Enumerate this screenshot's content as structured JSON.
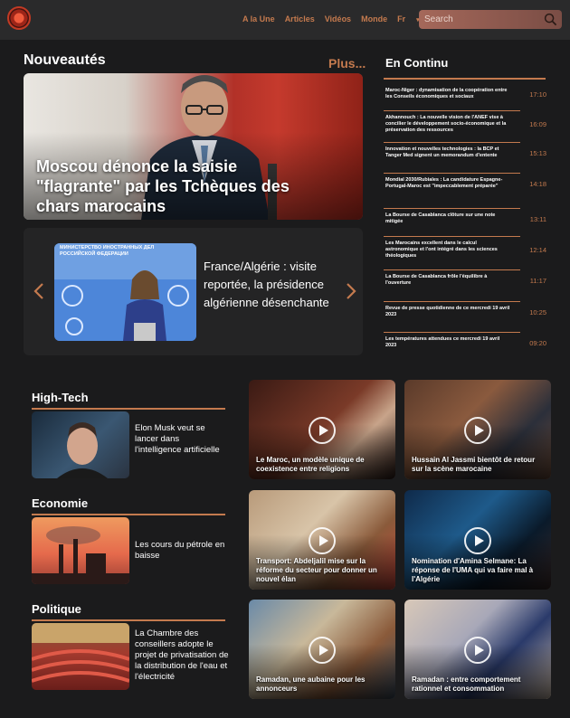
{
  "nav": {
    "items": [
      "A la Une",
      "Articles",
      "Vidéos",
      "Monde",
      "Fr"
    ]
  },
  "search": {
    "placeholder": "Search"
  },
  "nouveautes": {
    "title": "Nouveautés",
    "more": "Plus...",
    "hero_title": "Moscou dénonce la saisie \"flagrante\" par les Tchèques des chars marocains",
    "slide_text": "France/Algérie : visite reportée, la présidence algérienne désenchante",
    "slide_sign": "МИНИСТЕРСТВО ИНОСТРАННЫХ ДЕЛ РОССИЙСКОЙ ФЕДЕРАЦИИ"
  },
  "continu": {
    "title": "En Continu",
    "items": [
      {
        "text": "Maroc-Niger : dynamisation de la coopération entre les Conseils économiques et sociaux",
        "time": "17:10"
      },
      {
        "text": "Akhannouch : La nouvelle vision de l'ANEF vise à concilier le développement socio-économique et la préservation des ressources",
        "time": "16:09"
      },
      {
        "text": "Innovation et nouvelles technologies : la BCP et Tanger Med signent un memorandum d'entente",
        "time": "15:13"
      },
      {
        "text": "Mondial 2030/Rubiales : La candidature Espagne-Portugal-Maroc est \"impeccablement préparée\"",
        "time": "14:18"
      },
      {
        "text": "La Bourse de Casablanca clôture sur une note mitigée",
        "time": "13:11"
      },
      {
        "text": "Les Marocains excellent dans le calcul astronomique et l'ont intégré dans les sciences théologiques",
        "time": "12:14"
      },
      {
        "text": "La Bourse de Casablanca frôle l'équilibre à l'ouverture",
        "time": "11:17"
      },
      {
        "text": "Revue de presse quotidienne de ce mercredi 19 avril 2023",
        "time": "10:25"
      },
      {
        "text": "Les températures attendues ce mercredi 19 avril 2023",
        "time": "09:20"
      }
    ]
  },
  "categories": [
    {
      "title": "High-Tech",
      "text": "Elon Musk veut se lancer dans l'intelligence artificielle"
    },
    {
      "title": "Economie",
      "text": "Les cours du pétrole en baisse"
    },
    {
      "title": "Politique",
      "text": "La Chambre des conseillers adopte le projet de privatisation de la distribution de l'eau et l'électricité"
    }
  ],
  "videos": [
    {
      "caption": "Le Maroc, un modèle unique de coexistence entre religions"
    },
    {
      "caption": "Hussain Al Jassmi bientôt de retour sur la scène marocaine"
    },
    {
      "caption": "Transport: Abdeljalil mise sur la réforme du secteur pour donner un nouvel élan"
    },
    {
      "caption": "Nomination d'Amina Selmane: La réponse de l'UMA qui va faire mal à l'Algérie"
    },
    {
      "caption": "Ramadan, une aubaine pour les annonceurs"
    },
    {
      "caption": "Ramadan : entre comportement rationnel et consommation"
    }
  ],
  "colors": {
    "accent": "#c47a4e",
    "background": "#1b1b1c",
    "topbar": "#2a2a2b"
  }
}
